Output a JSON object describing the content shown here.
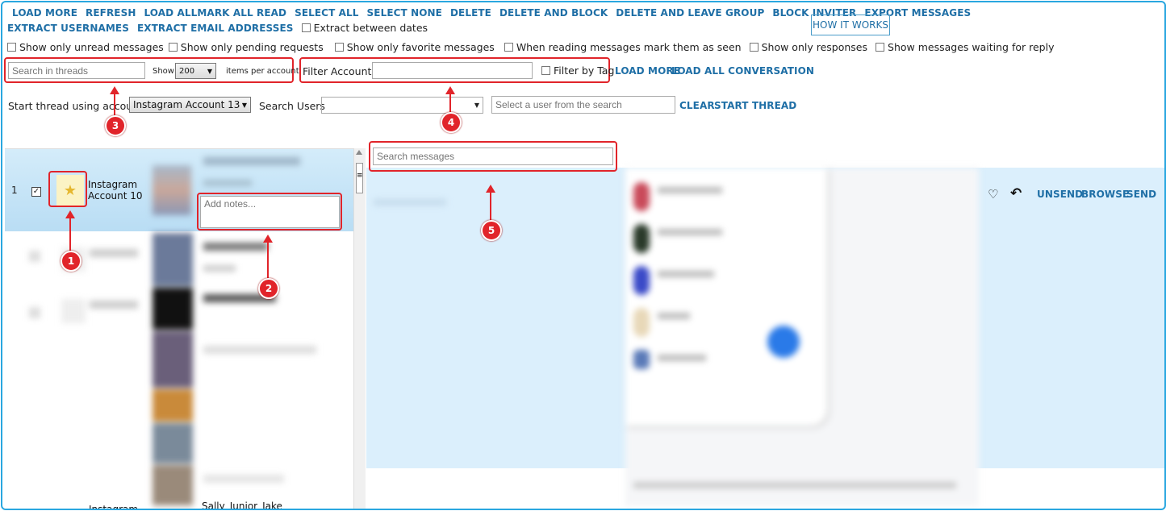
{
  "toolbar": {
    "row1": [
      "LOAD MORE",
      "REFRESH",
      "LOAD ALL",
      "MARK ALL READ",
      "SELECT ALL",
      "SELECT NONE",
      "DELETE",
      "DELETE AND BLOCK",
      "DELETE AND LEAVE GROUP",
      "BLOCK INVITER",
      "EXPORT MESSAGES"
    ],
    "row2": [
      "EXTRACT USERNAMES",
      "EXTRACT EMAIL ADDRESSES"
    ],
    "extract_between_dates": "Extract between dates",
    "how_it_works": "HOW IT WORKS"
  },
  "filters": {
    "unread": "Show only unread messages",
    "pending": "Show only pending requests",
    "favorite": "Show only favorite messages",
    "mark_seen": "When reading messages mark them as seen",
    "responses": "Show only responses",
    "waiting": "Show messages waiting for reply"
  },
  "search_threads": {
    "placeholder": "Search in threads",
    "show_label": "Show",
    "per_page": "200",
    "per_account_label": "items per account"
  },
  "filter_accounts": {
    "label": "Filter Accounts:",
    "filter_by_tag": "Filter by Tag",
    "load_more": "LOAD MORE",
    "load_all_conversation": "LOAD ALL CONVERSATION"
  },
  "start_thread": {
    "label": "Start thread using account",
    "account": "Instagram Account 13",
    "search_users_label": "Search Users",
    "user_placeholder": "Select a user from the search",
    "clear": "CLEAR",
    "start": "START THREAD"
  },
  "thread_list": {
    "selected": {
      "index": "1",
      "account_line1": "Instagram",
      "account_line2": "Account 10",
      "notes_placeholder": "Add notes..."
    },
    "bottom_partial": {
      "account": "Instagram",
      "username": "Sally_Junior_Jake"
    }
  },
  "conversation": {
    "search_placeholder": "Search messages",
    "unsend": "UNSEND",
    "browse": "BROWSE",
    "send": "SEND"
  },
  "markers": [
    "1",
    "2",
    "3",
    "4",
    "5"
  ]
}
